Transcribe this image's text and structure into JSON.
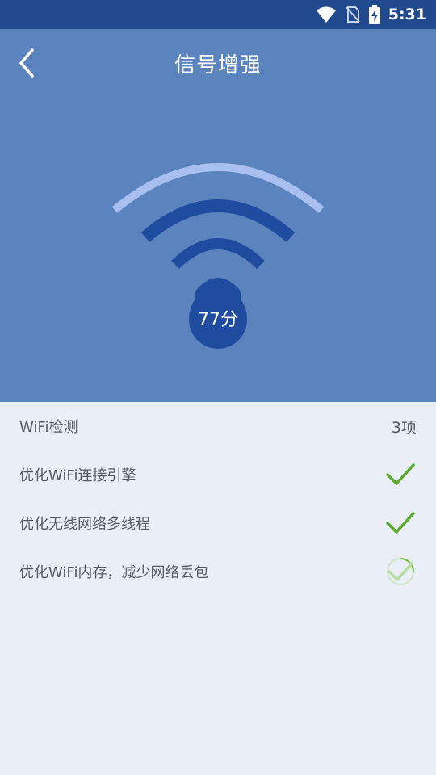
{
  "status_bar": {
    "time": "5:31",
    "icons": [
      "wifi-icon",
      "no-sim-icon",
      "battery-charging-icon"
    ]
  },
  "header": {
    "title": "信号增强",
    "back_icon": "chevron-left-icon",
    "score_text": "77分"
  },
  "colors": {
    "header_bg": "#5b84bf",
    "status_bg": "#214a8e",
    "wave_dark": "#1f4c9e",
    "wave_light": "#a9bff0",
    "check_green": "#5aaa2a"
  },
  "list": {
    "header_label": "WiFi检测",
    "header_count": "3项",
    "items": [
      {
        "label": "优化WiFi连接引擎",
        "status": "done"
      },
      {
        "label": "优化无线网络多线程",
        "status": "done"
      },
      {
        "label": "优化WiFi内存，减少网络丢包",
        "status": "in-progress"
      }
    ]
  }
}
